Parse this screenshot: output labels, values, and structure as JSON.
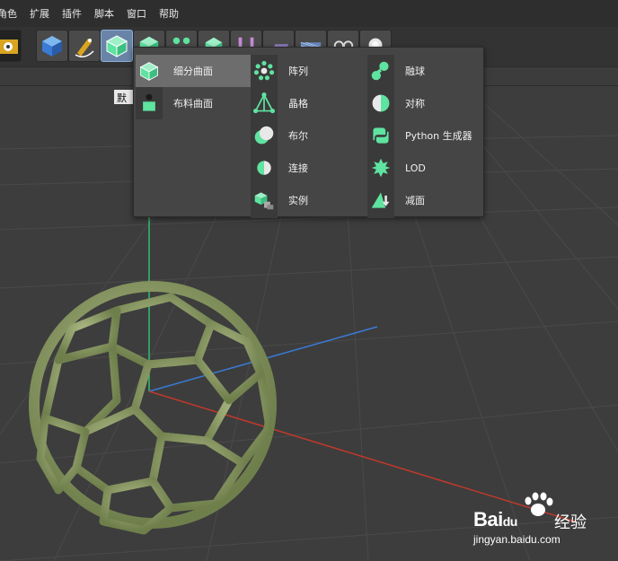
{
  "menubar": {
    "items": [
      "角色",
      "扩展",
      "插件",
      "脚本",
      "窗口",
      "帮助"
    ]
  },
  "toolbar": {
    "buttons": [
      {
        "icon": "clapper-gear-icon"
      },
      {
        "icon": "cube-icon"
      },
      {
        "icon": "pen-spline-icon"
      },
      {
        "icon": "subdivision-cube-icon",
        "active": true
      },
      {
        "icon": "generator-cube-icon"
      },
      {
        "icon": "cloner-icon"
      },
      {
        "icon": "deformer-icon"
      },
      {
        "icon": "bend-icon"
      },
      {
        "icon": "floor-icon"
      },
      {
        "icon": "scene-icon"
      },
      {
        "icon": "camera-icon"
      },
      {
        "icon": "light-icon"
      }
    ]
  },
  "viewport": {
    "tooltip": "默认"
  },
  "popup": {
    "col1": [
      {
        "label": "细分曲面",
        "icon": "subdivision-surface-icon",
        "selected": true
      },
      {
        "label": "布料曲面",
        "icon": "cloth-surface-icon",
        "selected": false
      }
    ],
    "col2": [
      {
        "label": "阵列",
        "icon": "array-icon"
      },
      {
        "label": "晶格",
        "icon": "atom-array-icon"
      },
      {
        "label": "布尔",
        "icon": "boole-icon"
      },
      {
        "label": "连接",
        "icon": "connect-icon"
      },
      {
        "label": "实例",
        "icon": "instance-icon"
      }
    ],
    "col3": [
      {
        "label": "融球",
        "icon": "metaball-icon"
      },
      {
        "label": "对称",
        "icon": "symmetry-icon"
      },
      {
        "label": "Python 生成器",
        "icon": "python-generator-icon"
      },
      {
        "label": "LOD",
        "icon": "lod-icon"
      },
      {
        "label": "减面",
        "icon": "polygon-reduction-icon"
      }
    ]
  },
  "watermark": {
    "brand": "Bai",
    "brand_paw": "du",
    "brand_cn": "经验",
    "url": "jingyan.baidu.com"
  },
  "colors": {
    "accent_green": "#5fe3a0",
    "mesh_green": "#8fa36a",
    "axis_x": "#c0392b",
    "axis_y": "#2fbf71",
    "axis_z": "#3a7bd5"
  }
}
